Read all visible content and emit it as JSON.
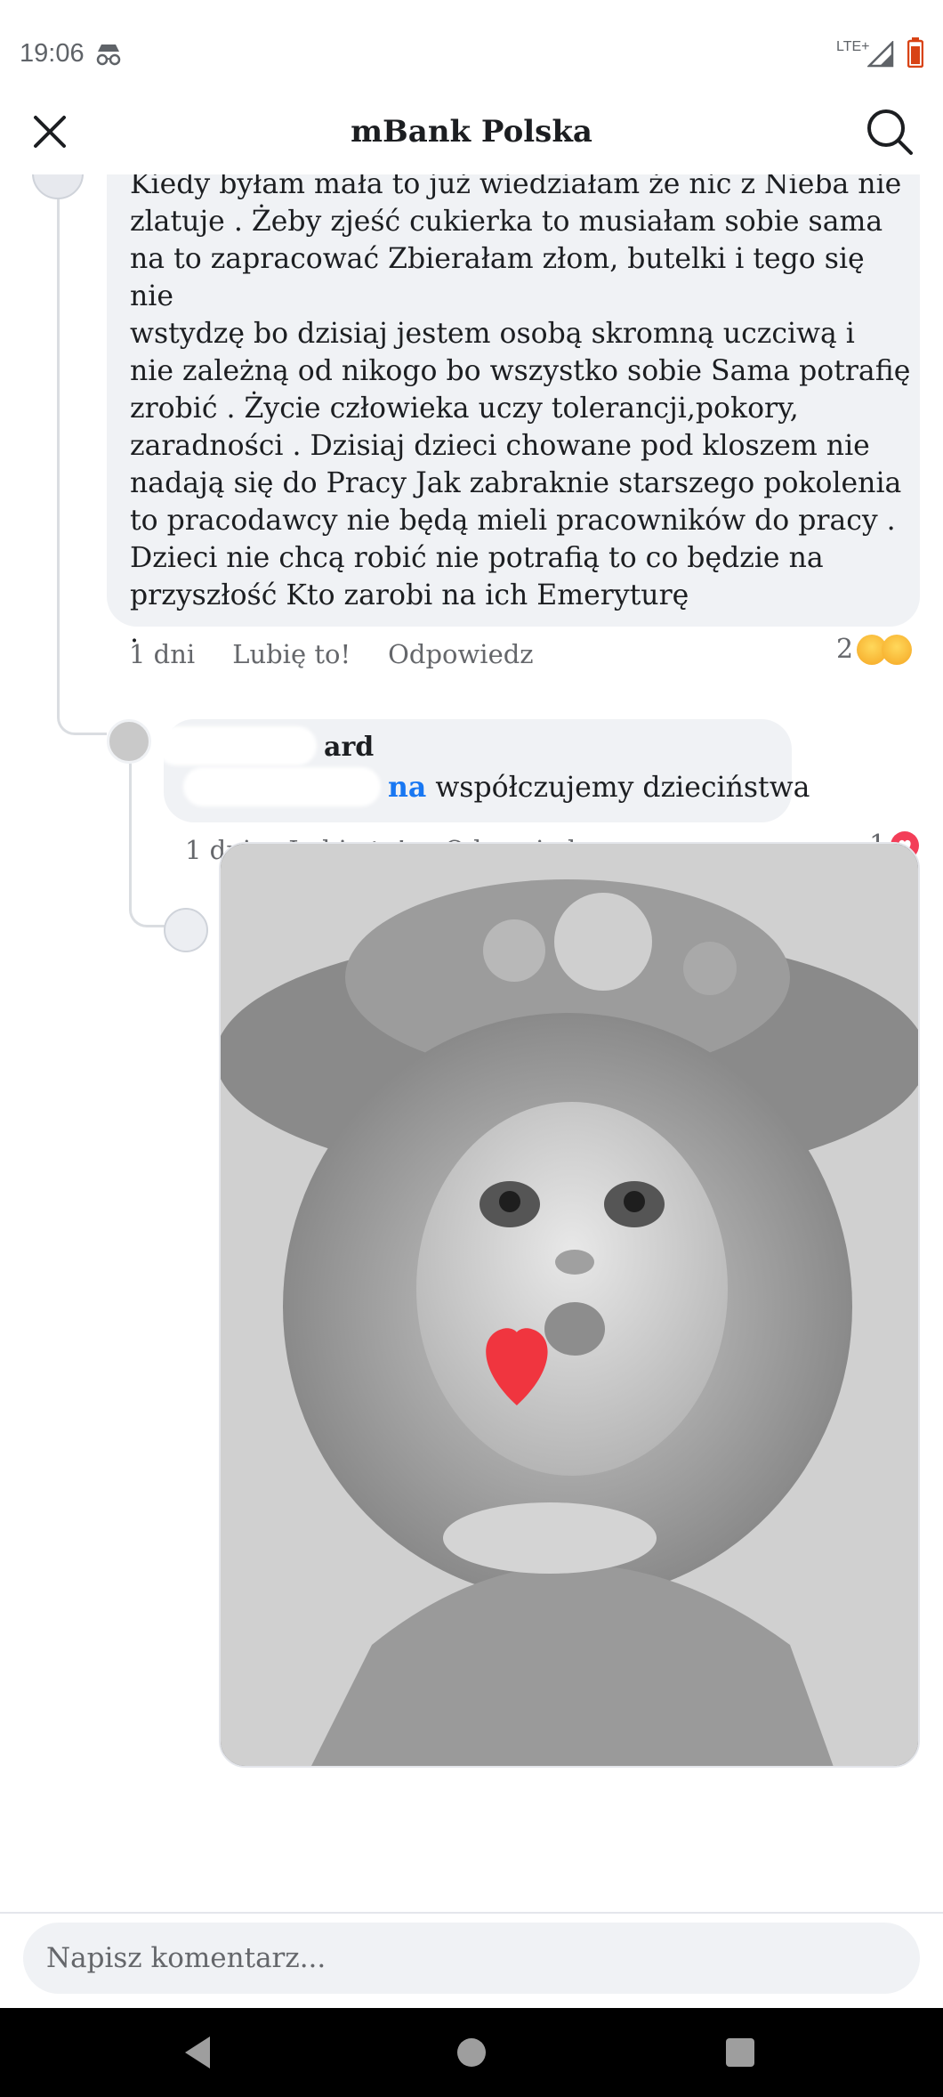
{
  "status_bar": {
    "time": "19:06",
    "network": "LTE+"
  },
  "header": {
    "title": "mBank Polska"
  },
  "comments": [
    {
      "text": "Kiedy byłam mała to już wiedziałam że nic z Nieba nie\nzlatuje . Żeby zjeść cukierka to musiałam sobie sama\nna to zapracować Zbierałam złom, butelki i tego się nie\nwstydzę bo dzisiaj jestem osobą skromną uczciwą i\nnie zależną od nikogo bo wszystko sobie Sama potrafię\nzrobić . Życie człowieka uczy tolerancji,pokory,\nzaradności . Dzisiaj dzieci chowane pod kloszem nie\nnadają się do Pracy Jak zabraknie starszego pokolenia\nto pracodawcy nie będą mieli pracowników do pracy .\nDzieci nie chcą robić nie potrafią to co będzie na\nprzyszłość Kto zarobi na ich Emeryturę\n.",
      "time": "1 dni",
      "like_label": "Lubię to!",
      "reply_label": "Odpowiedz",
      "reaction_count": "2",
      "reactions": [
        "haha-icon",
        "sad-icon"
      ]
    },
    {
      "author": "ard",
      "mention": "na",
      "text": "współczujemy dzieciństwa",
      "time": "1 dni",
      "like_label": "Lubię to!",
      "reply_label": "Odpowiedz",
      "reaction_count": "1",
      "reactions": [
        "love-icon"
      ]
    },
    {
      "author": "",
      "mention": "",
      "attachment": "girl-blowing-kiss-image"
    }
  ],
  "composer": {
    "placeholder": "Napisz komentarz..."
  },
  "colors": {
    "link": "#1877f2",
    "bubble": "#f0f2f5",
    "meta": "#65676b",
    "love": "#f33e58"
  }
}
